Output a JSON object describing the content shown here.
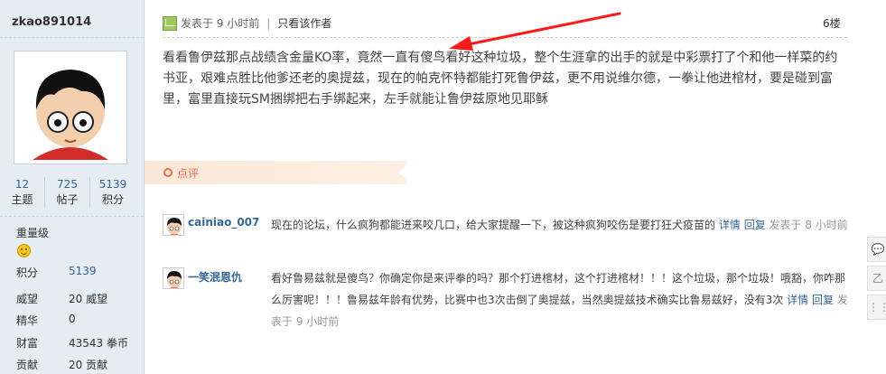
{
  "user": {
    "name": "zkao891014",
    "stats": [
      {
        "num": "12",
        "label": "主题"
      },
      {
        "num": "725",
        "label": "帖子"
      },
      {
        "num": "5139",
        "label": "积分"
      }
    ],
    "group": "重量级",
    "profile": [
      {
        "label": "积分",
        "value": "5139"
      },
      {
        "label": "威望",
        "value": "20 威望"
      },
      {
        "label": "精华",
        "value": "0"
      },
      {
        "label": "财富",
        "value": "43543 拳币"
      },
      {
        "label": "贡献",
        "value": "20 贡献"
      }
    ]
  },
  "post": {
    "posted": "发表于 9 小时前",
    "separator": "|",
    "only_author": "只看该作者",
    "floor": "6楼",
    "content": "看看鲁伊兹那点战绩含金量KO率，竟然一直有傻鸟看好这种垃圾，整个生涯拿的出手的就是中彩票打了个和他一样菜的约书亚，艰难点胜比他爹还老的奥提兹，现在的帕克怀特都能打死鲁伊兹，更不用说维尔德，一拳让他进棺材，要是碰到富里，富里直接玩SM捆绑把右手绑起来，左手就能让鲁伊兹原地见耶稣"
  },
  "rating": {
    "label": "点评"
  },
  "comments": [
    {
      "user": "cainiao_007",
      "text": "现在的论坛，什么疯狗都能进来咬几口，给大家提醒一下，被这种疯狗咬伤是要打狂犬疫苗的",
      "detail": "详情",
      "reply": "回复",
      "time": "发表于 8 小时前"
    },
    {
      "user": "一笑泯恩仇",
      "text": "看好鲁易兹就是傻鸟？你确定你是来评拳的吗？那个打进棺材，这个打进棺材！！！这个垃圾，那个垃圾！哦豁，你咋那么厉害呢！！！鲁易兹年龄有优势，比赛中也3次击倒了奥提兹，当然奥提兹技术确实比鲁易兹好，没有3次",
      "detail": "详情",
      "reply": "回复",
      "time": "发表于 9 小时前"
    }
  ],
  "right_tools": [
    "💬",
    "乙",
    "⋮⋮"
  ],
  "colors": {
    "sidebar_bg": "#e5edf2",
    "link": "#336699",
    "accent": "#f26c4f",
    "arrow": "#ff1a1a"
  }
}
